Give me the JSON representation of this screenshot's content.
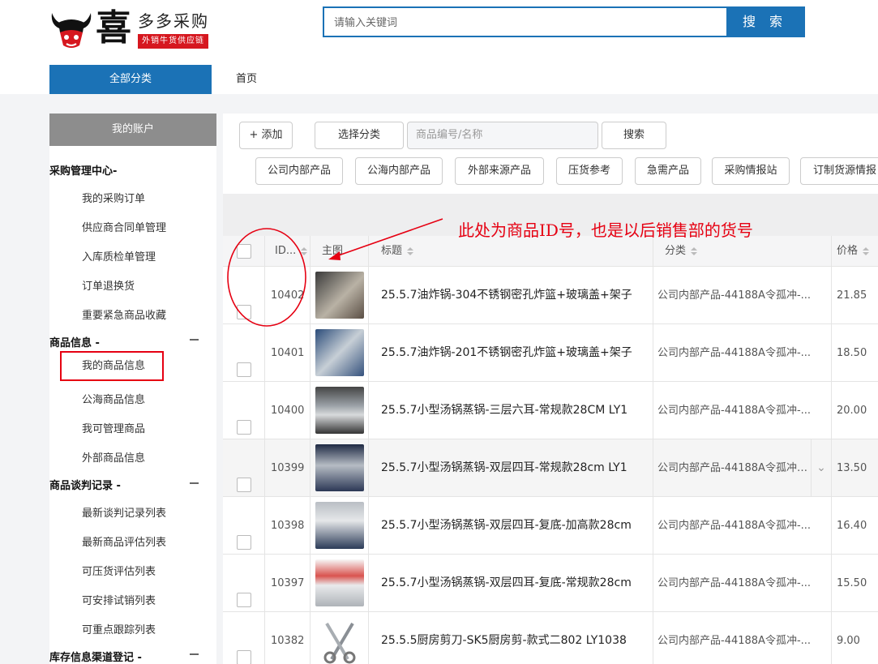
{
  "header": {
    "logo_char": "喜",
    "logo_name": "多多采购",
    "logo_tagline": "外销牛货供应链",
    "search_placeholder": "请输入关键词",
    "search_button": "搜 索"
  },
  "nav": {
    "all_categories": "全部分类",
    "home": "首页"
  },
  "sidebar": {
    "account": "我的账户",
    "sections": [
      {
        "title": "采购管理中心-",
        "items": [
          "我的采购订单",
          "供应商合同单管理",
          "入库质检单管理",
          "订单退换货",
          "重要紧急商品收藏"
        ]
      },
      {
        "title": "商品信息 -",
        "items": [
          "我的商品信息",
          "公海商品信息",
          "我可管理商品",
          "外部商品信息"
        ]
      },
      {
        "title": "商品谈判记录 -",
        "items": [
          "最新谈判记录列表",
          "最新商品评估列表",
          "可压货评估列表",
          "可安排试销列表",
          "可重点跟踪列表"
        ]
      },
      {
        "title": "库存信息渠道登记 -",
        "items": []
      }
    ],
    "active_item": "我的商品信息"
  },
  "toolbar": {
    "add": "+ 添加",
    "select_category": "选择分类",
    "product_input_placeholder": "商品编号/名称",
    "search": "搜索",
    "filters": [
      "公司内部产品",
      "公海内部产品",
      "外部来源产品",
      "压货参考",
      "急需产品",
      "采购情报站",
      "订制货源情报"
    ]
  },
  "table": {
    "columns": {
      "id": "ID...",
      "image": "主图",
      "title": "标题",
      "category": "分类",
      "price": "价格"
    },
    "rows": [
      {
        "id": "10402",
        "title": "25.5.7油炸锅-304不锈钢密孔炸篮+玻璃盖+架子",
        "category": "公司内部产品-44188A令孤冲-...",
        "price": "21.85",
        "img": "fryer-dark"
      },
      {
        "id": "10401",
        "title": "25.5.7油炸锅-201不锈钢密孔炸篮+玻璃盖+架子",
        "category": "公司内部产品-44188A令孤冲-...",
        "price": "18.50",
        "img": "fryer-blue"
      },
      {
        "id": "10400",
        "title": "25.5.7小型汤锅蒸锅-三层六耳-常规款28CM LY1",
        "category": "公司内部产品-44188A令孤冲-...",
        "price": "20.00",
        "img": "steamer-3"
      },
      {
        "id": "10399",
        "title": "25.5.7小型汤锅蒸锅-双层四耳-常规款28cm LY1",
        "category": "公司内部产品-44188A令孤冲-...",
        "price": "13.50",
        "img": "steamer-2"
      },
      {
        "id": "10398",
        "title": "25.5.7小型汤锅蒸锅-双层四耳-复底-加高款28cm",
        "category": "公司内部产品-44188A令孤冲-...",
        "price": "16.40",
        "img": "steamer-tall"
      },
      {
        "id": "10397",
        "title": "25.5.7小型汤锅蒸锅-双层四耳-复底-常规款28cm",
        "category": "公司内部产品-44188A令孤冲-...",
        "price": "15.50",
        "img": "steamer-box"
      },
      {
        "id": "10382",
        "title": "25.5.5厨房剪刀-SK5厨房剪-款式二802 LY1038",
        "category": "公司内部产品-44188A令孤冲-...",
        "price": "9.00",
        "img": "scissors"
      }
    ]
  },
  "annotation": {
    "text": "此处为商品ID号，也是以后销售部的货号"
  },
  "colors": {
    "brand_blue": "#1b72b6",
    "annotation_red": "#e60012"
  }
}
